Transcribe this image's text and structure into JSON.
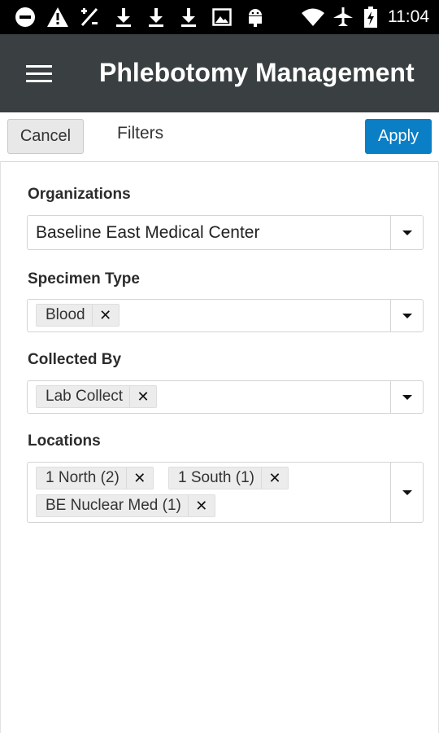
{
  "status_bar": {
    "time": "11:04",
    "icons": [
      "do-not-disturb-icon",
      "warning-icon",
      "percent-icon",
      "download-icon",
      "download-icon",
      "download-icon",
      "image-icon",
      "android-icon",
      "wifi-icon",
      "airplane-icon",
      "battery-charging-icon"
    ]
  },
  "app_bar": {
    "title": "Phlebotomy Management",
    "menu_icon": "hamburger-menu-icon"
  },
  "filter_bar": {
    "cancel_label": "Cancel",
    "title": "Filters",
    "apply_label": "Apply",
    "apply_color": "#0b7fc5"
  },
  "filters": {
    "organizations": {
      "label": "Organizations",
      "value": "Baseline East Medical Center"
    },
    "specimen_type": {
      "label": "Specimen Type",
      "chips": [
        "Blood"
      ]
    },
    "collected_by": {
      "label": "Collected By",
      "chips": [
        "Lab Collect"
      ]
    },
    "locations": {
      "label": "Locations",
      "chips": [
        "1 North (2)",
        "1 South (1)",
        "BE Nuclear Med (1)"
      ]
    }
  }
}
